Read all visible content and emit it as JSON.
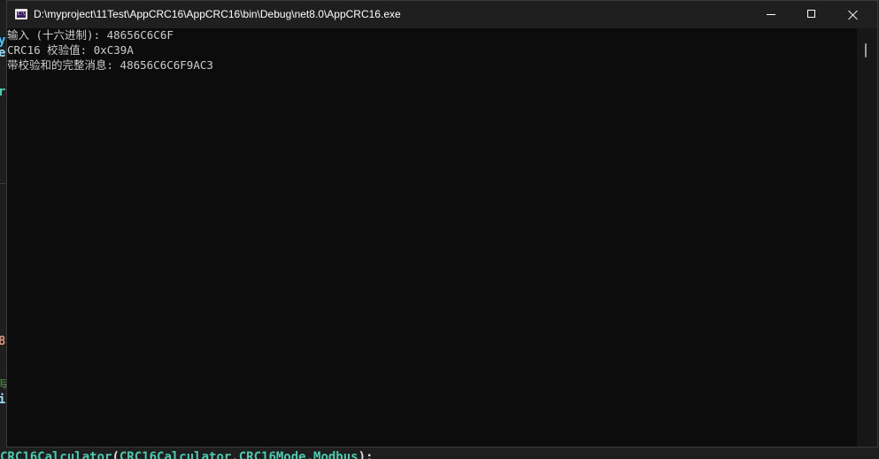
{
  "background_editor": {
    "fragments": [
      "y",
      "e",
      "r",
      "8",
      "写",
      "i"
    ],
    "bottom_line": {
      "part1": "CRC16Calculator",
      "part2": "(",
      "part3": "CRC16Calculator.CRC16Mode.Modbus",
      "part4": ");"
    }
  },
  "window": {
    "title": "D:\\myproject\\11Test\\AppCRC16\\AppCRC16\\bin\\Debug\\net8.0\\AppCRC16.exe",
    "icon": "console-app-icon",
    "icon_label": "C:\\"
  },
  "console": {
    "lines": [
      "输入 (十六进制): 48656C6C6F",
      "CRC16 校验值: 0xC39A",
      "带校验和的完整消息: 48656C6C6F9AC3"
    ]
  },
  "colors": {
    "console_bg": "#0c0c0c",
    "console_text": "#cccccc",
    "titlebar_bg": "#1f1f1f"
  }
}
